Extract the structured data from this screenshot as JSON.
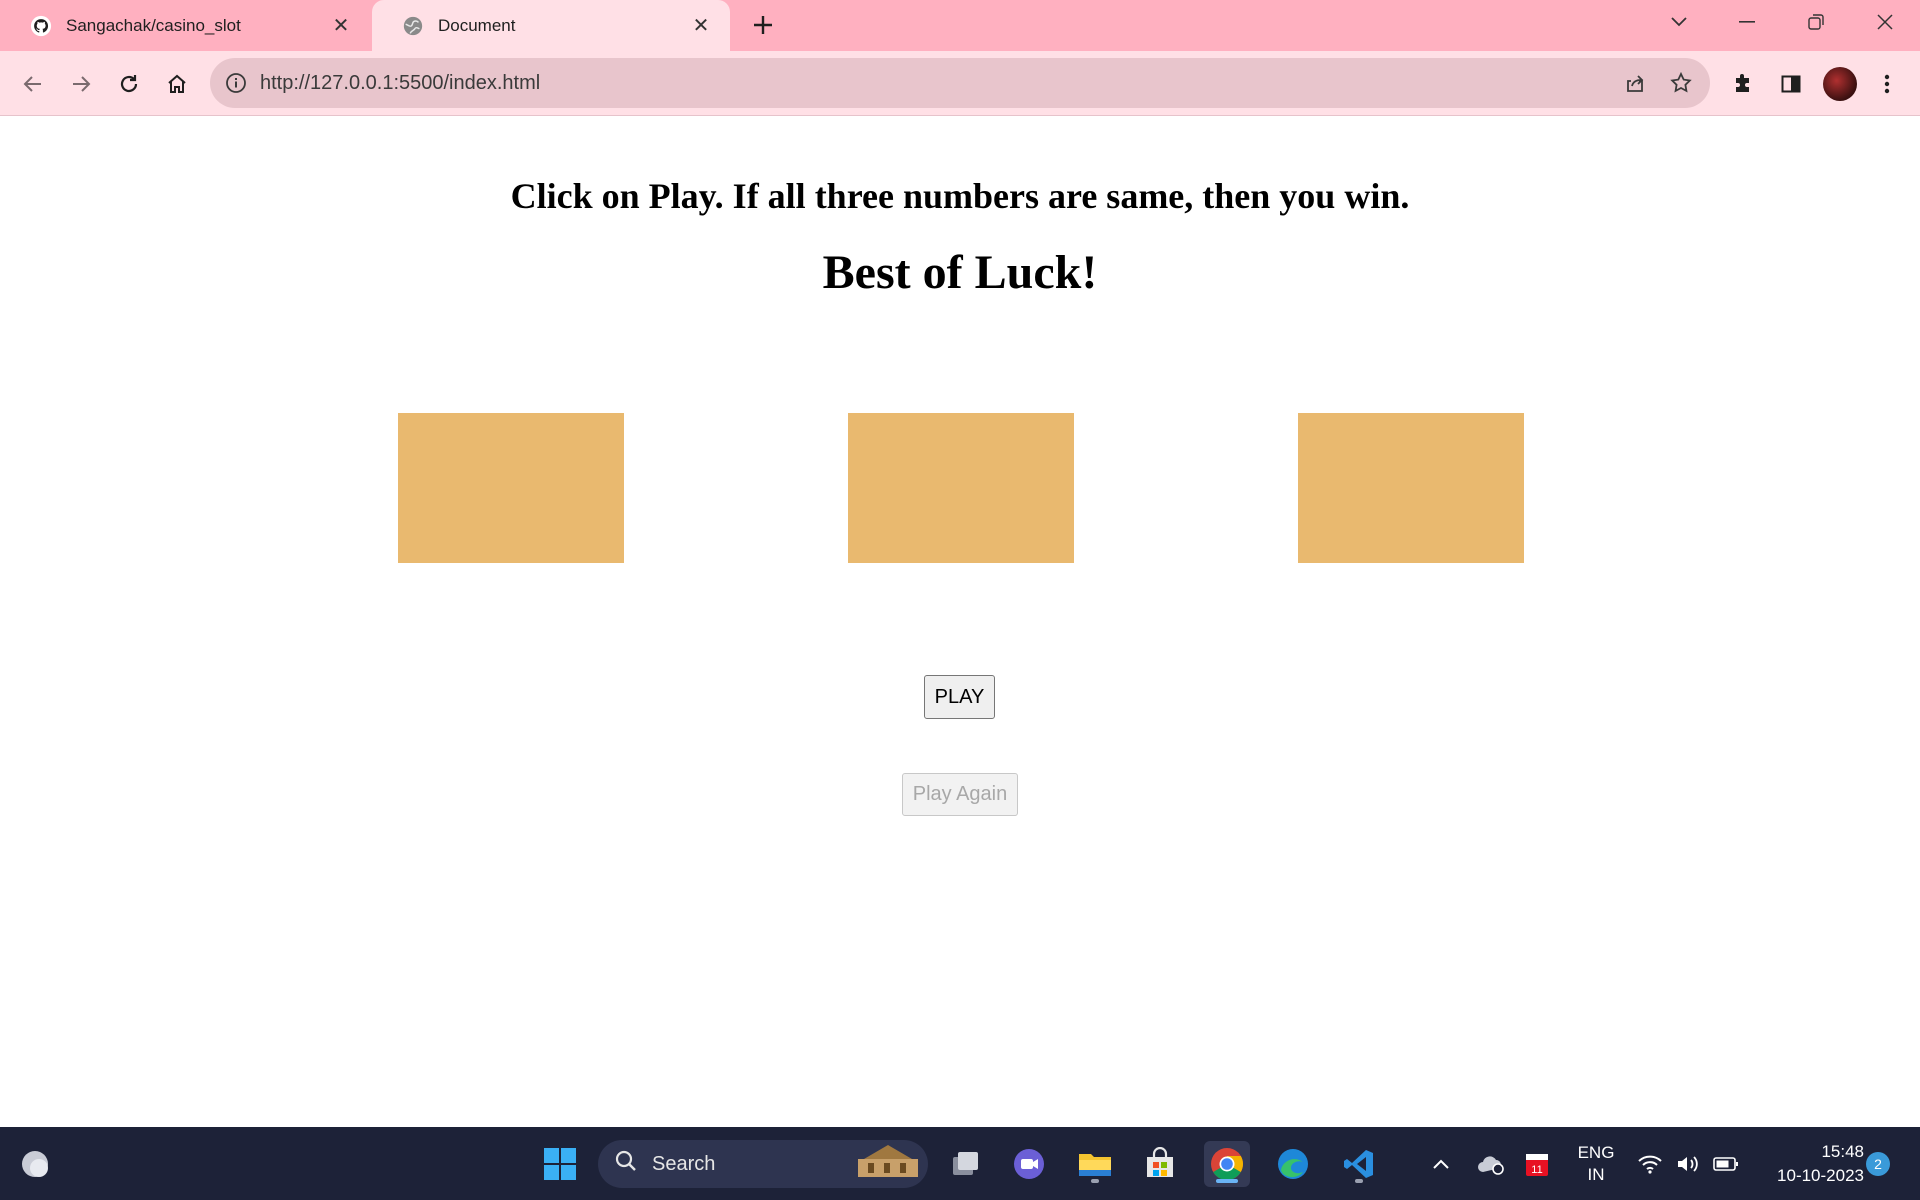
{
  "browser": {
    "tabs": [
      {
        "title": "Sangachak/casino_slot",
        "favicon": "github-icon"
      },
      {
        "title": "Document",
        "favicon": "globe-icon"
      }
    ],
    "url": "http://127.0.0.1:5500/index.html"
  },
  "page": {
    "instruction": "Click on Play. If all three numbers are same, then you win.",
    "luck": "Best of Luck!",
    "slots": [
      "",
      "",
      ""
    ],
    "play_label": "PLAY",
    "play_again_label": "Play Again",
    "slot_color": "#e9b96f"
  },
  "taskbar": {
    "search_label": "Search",
    "lang_line1": "ENG",
    "lang_line2": "IN",
    "time": "15:48",
    "date": "10-10-2023",
    "notification_count": "2",
    "calendar_badge": "11"
  },
  "colors": {
    "tabstrip": "#ffb0c0",
    "toolbar": "#ffe0e6",
    "taskbar": "#1d2238"
  }
}
